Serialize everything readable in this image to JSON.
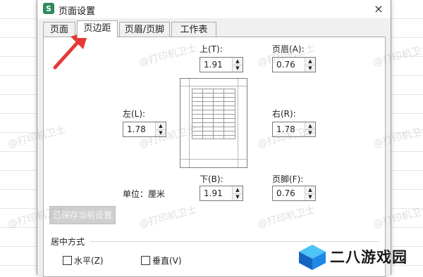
{
  "dialog": {
    "title": "页面设置",
    "app_icon_letter": "S",
    "close_glyph": "×"
  },
  "tabs": [
    {
      "label": "页面"
    },
    {
      "label": "页边距",
      "active": true
    },
    {
      "label": "页眉/页脚"
    },
    {
      "label": "工作表"
    }
  ],
  "margins": {
    "top_label": "上(T):",
    "top_value": "1.91",
    "header_label": "页眉(A):",
    "header_value": "0.76",
    "left_label": "左(L):",
    "left_value": "1.78",
    "right_label": "右(R):",
    "right_value": "1.78",
    "bottom_label": "下(B):",
    "bottom_value": "1.91",
    "footer_label": "页脚(F):",
    "footer_value": "0.76",
    "unit_text": "单位：厘米"
  },
  "saved_settings_button": "已保存当前设置",
  "center_section": {
    "title": "居中方式",
    "horizontal_label": "水平(Z)",
    "vertical_label": "垂直(V)"
  },
  "watermark_text": "@打印机卫士",
  "brand_logo_text": "二八游戏园",
  "colors": {
    "arrow": "#e53935",
    "app_icon": "#2e8b57",
    "logo_blue": "#1e88e5"
  }
}
